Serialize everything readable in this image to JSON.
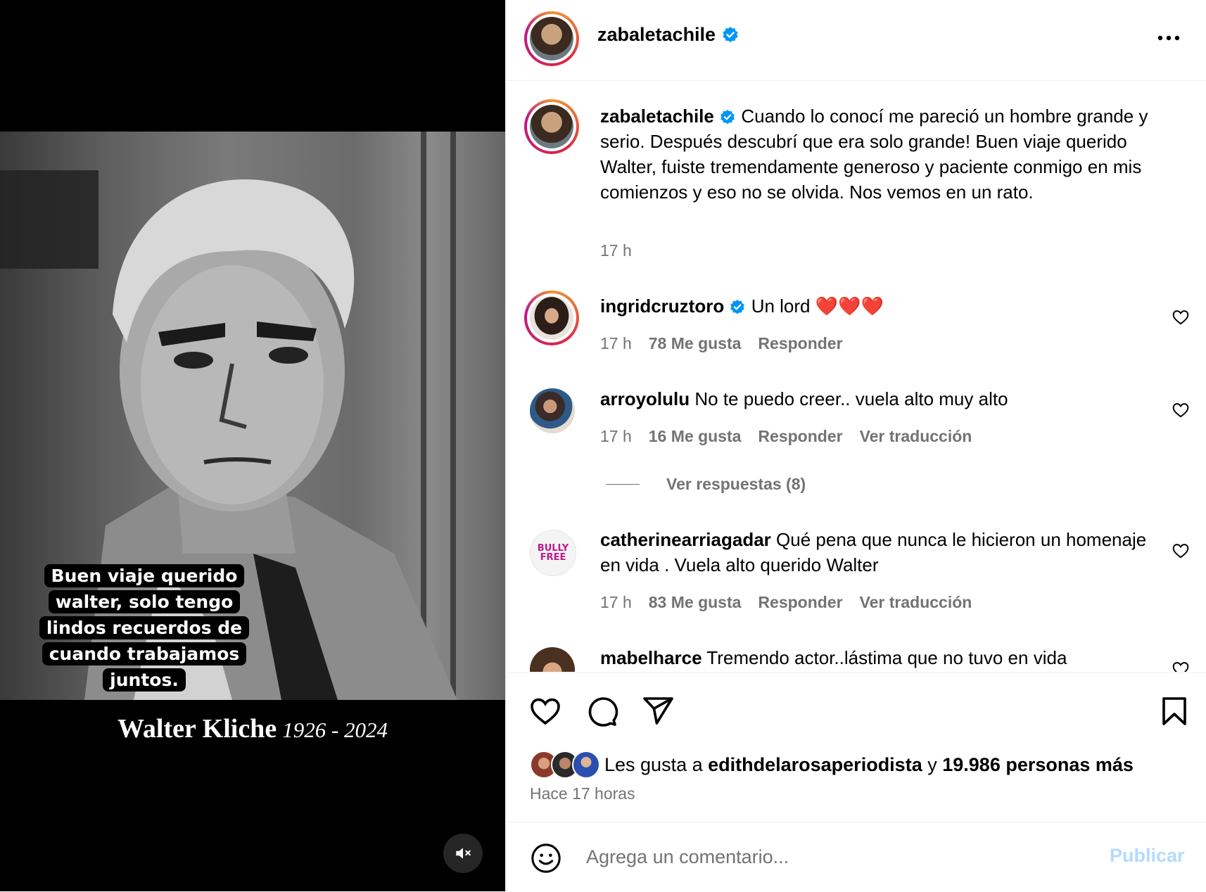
{
  "video": {
    "subtitle": "Buen viaje querido walter, solo tengo lindos recuerdos de cuando trabajamos juntos.",
    "caption_name": "Walter Kliche",
    "caption_years": "1926 - 2024",
    "mute_icon": "speaker-muted-icon"
  },
  "header": {
    "username": "zabaletachile",
    "verified": true,
    "more_icon": "more-horizontal-icon"
  },
  "caption": {
    "username": "zabaletachile",
    "text": "Cuando lo conocí me pareció un hombre grande y serio. Después descubrí que era solo grande! Buen viaje querido Walter, fuiste tremendamente generoso y paciente conmigo en mis comienzos y eso no se olvida. Nos vemos en un rato.",
    "time": "17 h"
  },
  "comments": [
    {
      "username": "ingridcruztoro",
      "verified": true,
      "text": "Un lord ❤️❤️❤️",
      "time": "17 h",
      "likes": "78 Me gusta",
      "reply": "Responder"
    },
    {
      "username": "arroyolulu",
      "text": "No te puedo creer.. vuela alto muy alto",
      "time": "17 h",
      "likes": "16 Me gusta",
      "reply": "Responder",
      "translate": "Ver traducción",
      "view_replies": "Ver respuestas (8)"
    },
    {
      "username": "catherinearriagadar",
      "text": "Qué pena que nunca le hicieron un homenaje en vida . Vuela alto querido Walter",
      "time": "17 h",
      "likes": "83 Me gusta",
      "reply": "Responder",
      "translate": "Ver traducción",
      "avatar_text": "BULLY FREE"
    },
    {
      "username": "mabelharce",
      "text": "Tremendo actor..lástima que no tuvo en vida"
    }
  ],
  "actions": {
    "like_icon": "heart-icon",
    "comment_icon": "comment-bubble-icon",
    "share_icon": "send-icon",
    "save_icon": "bookmark-icon"
  },
  "likes_summary": {
    "prefix": "Les gusta a",
    "user": "edithdelarosaperiodista",
    "connector": "y",
    "others": "19.986 personas más"
  },
  "posted_ago": "Hace 17 horas",
  "add_comment": {
    "placeholder": "Agrega un comentario...",
    "emoji_icon": "emoji-icon",
    "publish_label": "Publicar"
  },
  "colors": {
    "verified_blue": "#0095f6",
    "secondary_text": "#737373",
    "publish_disabled": "#b3dbff",
    "story_ring": [
      "#f09433",
      "#dc2743",
      "#bc1888"
    ]
  }
}
